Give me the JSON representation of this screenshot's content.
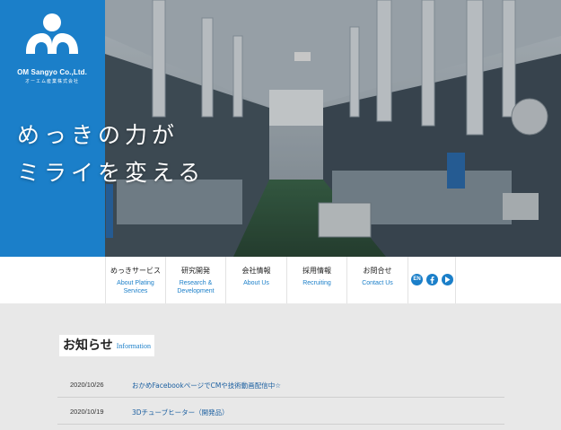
{
  "company": {
    "name_en": "OM Sangyo Co.,Ltd.",
    "name_jp": "オーエム産業株式会社"
  },
  "hero": {
    "catch_line1": "めっきの力が",
    "catch_line2": "ミライを変える"
  },
  "nav": {
    "items": [
      {
        "jp": "めっきサービス",
        "en": "About Plating Services"
      },
      {
        "jp": "研究開発",
        "en": "Research & Development"
      },
      {
        "jp": "会社情報",
        "en": "About Us"
      },
      {
        "jp": "採用情報",
        "en": "Recruiting"
      },
      {
        "jp": "お問合せ",
        "en": "Contact Us"
      }
    ],
    "lang_label": "EN",
    "facebook_icon": "facebook-icon",
    "youtube_icon": "play-icon"
  },
  "info": {
    "title_jp": "お知らせ",
    "title_en": "Information",
    "news": [
      {
        "date": "2020/10/26",
        "title": "おかめFacebookページでCMや技術動画配信中☆"
      },
      {
        "date": "2020/10/19",
        "title": "3Dチューブヒーター（開発品）"
      }
    ]
  },
  "colors": {
    "brand_blue": "#1b7fc9",
    "background": "#e8e8e8"
  }
}
